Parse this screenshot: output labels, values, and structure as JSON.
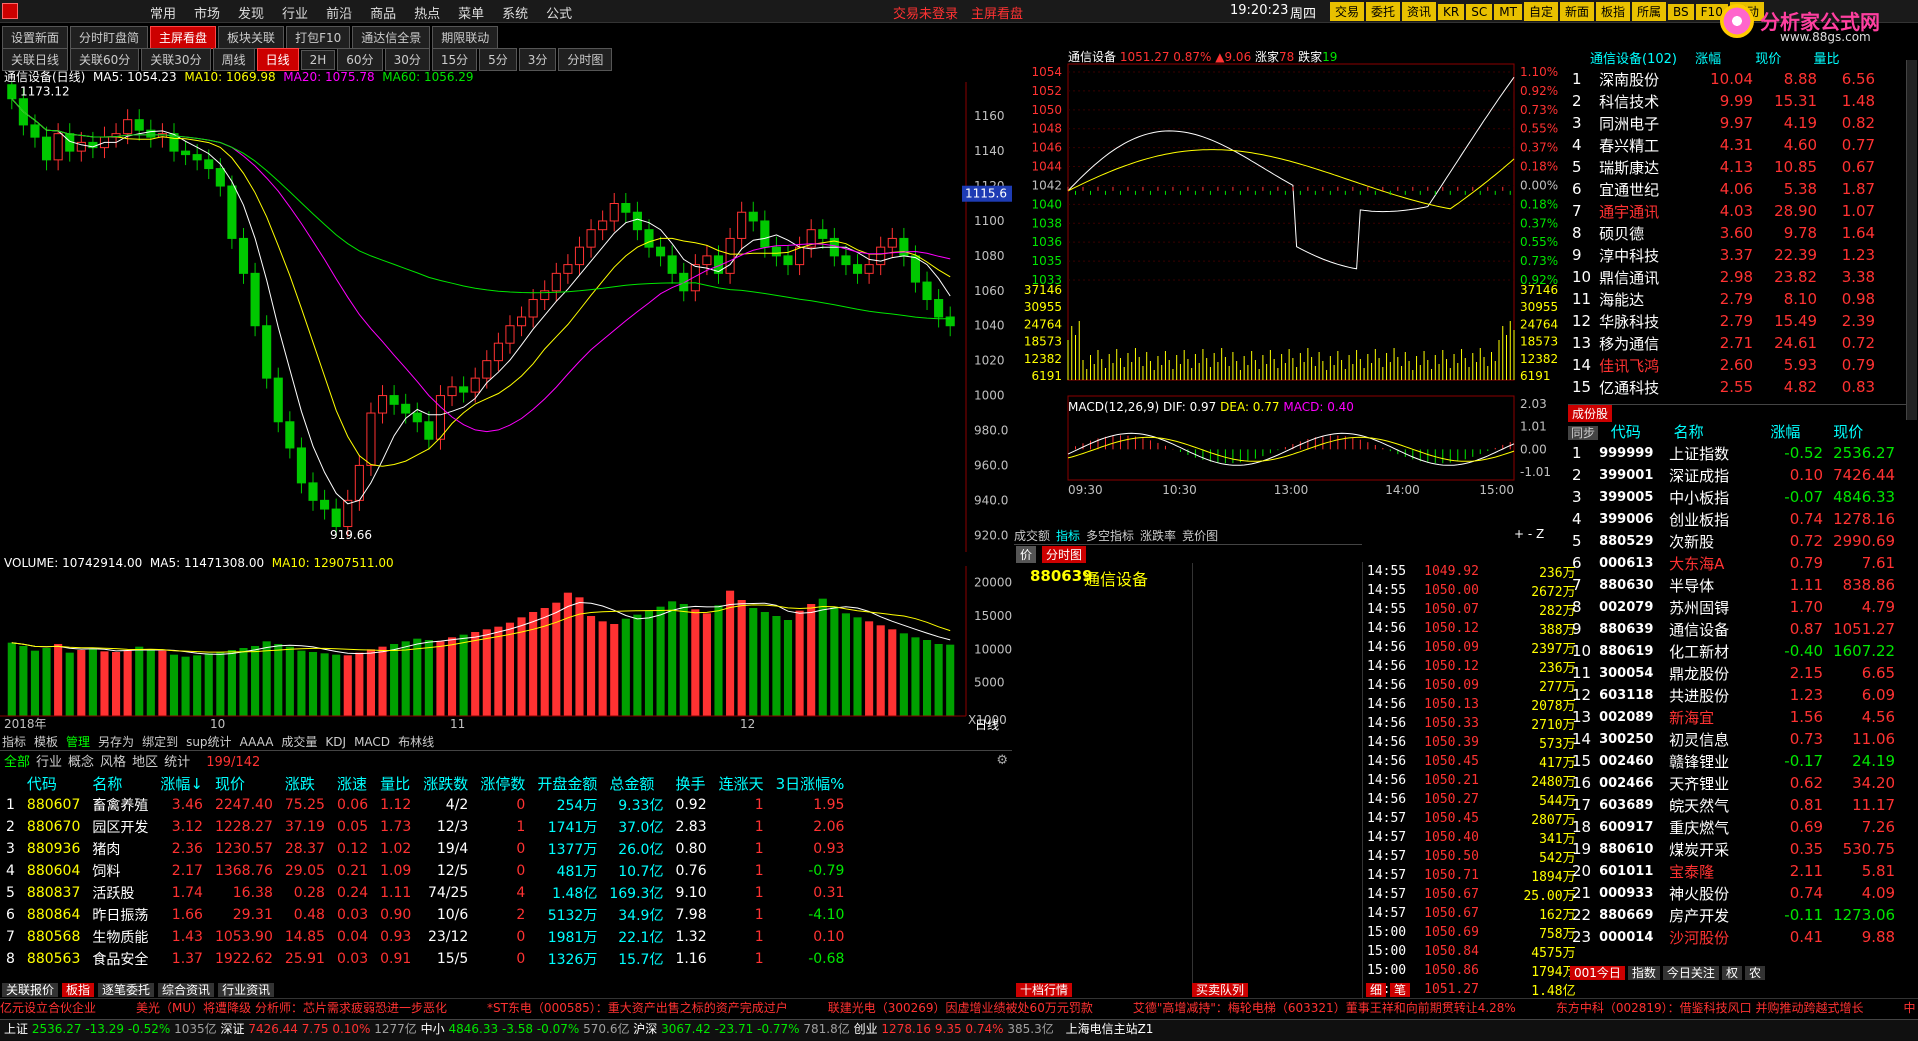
{
  "menu": {
    "items": [
      "常用",
      "市场",
      "发现",
      "行业",
      "前沿",
      "商品",
      "热点",
      "菜单",
      "系统",
      "公式"
    ],
    "login_hint": "交易未登录",
    "layout_name": "主屏看盘",
    "clock": "19:20:23",
    "weekday": "周四"
  },
  "toolbar": {
    "buttons": [
      "交易",
      "委托",
      "资讯",
      "KR",
      "SC",
      "MT",
      "自定",
      "新面",
      "板指",
      "所属",
      "BS",
      "F10",
      "联动"
    ]
  },
  "logo": {
    "text": "分析家公式网",
    "url": "www.88gs.com"
  },
  "top_tabs": [
    "设置新面",
    "分时盯盘简",
    "主屏看盘",
    "板块关联",
    "打包F10",
    "通达信全景",
    "期限联动"
  ],
  "period_tabs": [
    "关联日线",
    "关联60分",
    "关联30分",
    "周线",
    "日线",
    "2H",
    "60分",
    "30分",
    "15分",
    "5分",
    "3分",
    "分时图"
  ],
  "kline": {
    "title": "通信设备(日线)",
    "ma5": "MA5: 1054.23",
    "ma10": "MA10: 1069.98",
    "ma20": "MA20: 1075.78",
    "ma60": "MA60: 1056.29",
    "high_mark": "1173.12",
    "low_mark": "919.66",
    "price_ticks": [
      "1160",
      "1140",
      "1120",
      "1100",
      "1080",
      "1060",
      "1040",
      "1020",
      "1000",
      "980.0",
      "960.0",
      "940.0",
      "920.0"
    ],
    "last_price_tag": "1115.6"
  },
  "volume": {
    "label": "VOLUME: 10742914.00",
    "ma5": "MA5: 11471308.00",
    "ma10": "MA10: 12907511.00",
    "ticks": [
      "20000",
      "15000",
      "10000",
      "5000",
      "X1000"
    ],
    "dates": [
      "2018年",
      "10",
      "11",
      "12"
    ]
  },
  "indicator_tabs": [
    "指标",
    "模板",
    "管理",
    "另存为",
    "绑定到",
    "sup统计",
    "AAAA",
    "成交量",
    "KDJ",
    "MACD",
    "布林线"
  ],
  "period_label": "日线",
  "board": {
    "filter_tabs": [
      "全部",
      "行业",
      "概念",
      "风格",
      "地区",
      "统计"
    ],
    "count": "199/142",
    "headers": [
      "代码",
      "名称",
      "涨幅↓",
      "现价",
      "涨跌",
      "涨速",
      "量比",
      "涨跌数",
      "涨停数",
      "开盘金额",
      "总金额",
      "换手",
      "连涨天",
      "3日涨幅%"
    ],
    "rows": [
      [
        "1",
        "880607",
        "畜禽养殖",
        "3.46",
        "2247.40",
        "75.25",
        "0.06",
        "1.12",
        "4/2",
        "0",
        "254万",
        "9.33亿",
        "0.92",
        "1",
        "1.95"
      ],
      [
        "2",
        "880670",
        "园区开发",
        "3.12",
        "1228.27",
        "37.19",
        "0.05",
        "1.73",
        "12/3",
        "1",
        "1741万",
        "37.0亿",
        "2.83",
        "1",
        "2.06"
      ],
      [
        "3",
        "880936",
        "猪肉",
        "2.36",
        "1230.57",
        "28.37",
        "0.12",
        "1.02",
        "19/4",
        "0",
        "1377万",
        "26.0亿",
        "0.80",
        "1",
        "0.93"
      ],
      [
        "4",
        "880604",
        "饲料",
        "2.17",
        "1368.76",
        "29.05",
        "0.21",
        "1.09",
        "12/5",
        "0",
        "481万",
        "10.7亿",
        "0.76",
        "1",
        "-0.79"
      ],
      [
        "5",
        "880837",
        "活跃股",
        "1.74",
        "16.38",
        "0.28",
        "0.24",
        "1.11",
        "74/25",
        "4",
        "1.48亿",
        "169.3亿",
        "9.10",
        "1",
        "0.31"
      ],
      [
        "6",
        "880864",
        "昨日振荡",
        "1.66",
        "29.31",
        "0.48",
        "0.03",
        "0.90",
        "10/6",
        "2",
        "5132万",
        "34.9亿",
        "7.98",
        "1",
        "-4.10"
      ],
      [
        "7",
        "880568",
        "生物质能",
        "1.43",
        "1053.90",
        "14.85",
        "0.04",
        "0.93",
        "23/12",
        "0",
        "1981万",
        "22.1亿",
        "1.32",
        "1",
        "0.10"
      ],
      [
        "8",
        "880563",
        "食品安全",
        "1.37",
        "1922.62",
        "25.91",
        "0.03",
        "0.91",
        "15/5",
        "0",
        "1326万",
        "15.7亿",
        "1.16",
        "1",
        "-0.68"
      ]
    ]
  },
  "bottom_left_tabs": [
    "关联报价",
    "板指",
    "逐笔委托",
    "综合资讯",
    "行业资讯"
  ],
  "intraday": {
    "title": "通信设备",
    "price": "1051.27",
    "pct": "0.87%",
    "chg": "▲9.06",
    "up_label": "涨家",
    "up": "78",
    "down_label": "跌家",
    "down": "19",
    "price_ticks": [
      "1054",
      "1052",
      "1050",
      "1048",
      "1046",
      "1044",
      "1042",
      "1040",
      "1038",
      "1036",
      "1035",
      "1033"
    ],
    "pct_ticks": [
      "1.10%",
      "0.92%",
      "0.73%",
      "0.55%",
      "0.37%",
      "0.18%",
      "0.00%",
      "0.18%",
      "0.37%",
      "0.55%",
      "0.73%",
      "0.92%"
    ],
    "vol_ticks": [
      "37146",
      "30955",
      "24764",
      "18573",
      "12382",
      "6191"
    ],
    "macd_label": "MACD(12,26,9)",
    "dif": "DIF: 0.97",
    "dea": "DEA: 0.77",
    "macd": "MACD: 0.40",
    "macd_ticks": [
      "2.03",
      "1.01",
      "0.00",
      "-1.01"
    ],
    "time_ticks": [
      "09:30",
      "10:30",
      "13:00",
      "14:00",
      "15:00"
    ],
    "tabs": [
      "成交额",
      "指标",
      "多空指标",
      "涨跌率",
      "竞价图"
    ]
  },
  "quote": {
    "tab": "分时图",
    "code": "880639",
    "name": "通信设备",
    "bottom_tabs": [
      "十档行情",
      "买卖队列"
    ]
  },
  "ticks": {
    "rows": [
      [
        "14:55",
        "1049.92",
        "236万"
      ],
      [
        "14:55",
        "1050.00",
        "2672万"
      ],
      [
        "14:55",
        "1050.07",
        "282万"
      ],
      [
        "14:56",
        "1050.12",
        "388万"
      ],
      [
        "14:56",
        "1050.09",
        "2397万"
      ],
      [
        "14:56",
        "1050.12",
        "236万"
      ],
      [
        "14:56",
        "1050.09",
        "277万"
      ],
      [
        "14:56",
        "1050.13",
        "2078万"
      ],
      [
        "14:56",
        "1050.33",
        "2710万"
      ],
      [
        "14:56",
        "1050.39",
        "573万"
      ],
      [
        "14:56",
        "1050.45",
        "417万"
      ],
      [
        "14:56",
        "1050.21",
        "2480万"
      ],
      [
        "14:56",
        "1050.27",
        "544万"
      ],
      [
        "14:57",
        "1050.45",
        "2807万"
      ],
      [
        "14:57",
        "1050.40",
        "341万"
      ],
      [
        "14:57",
        "1050.50",
        "542万"
      ],
      [
        "14:57",
        "1050.71",
        "1894万"
      ],
      [
        "14:57",
        "1050.67",
        "25.00万"
      ],
      [
        "14:57",
        "1050.67",
        "162万"
      ],
      [
        "15:00",
        "1050.69",
        "758万"
      ],
      [
        "15:00",
        "1050.84",
        "4575万"
      ],
      [
        "15:00",
        "1050.86",
        "1794万"
      ],
      [
        "15:00",
        "1051.27",
        "1.48亿"
      ]
    ],
    "bottom_tabs": [
      "细",
      "笔"
    ]
  },
  "members": {
    "title": "通信设备",
    "count": "(102)",
    "headers": [
      "涨幅",
      "现价",
      "量比"
    ],
    "rows": [
      [
        "1",
        "深南股份",
        "10.04",
        "8.88",
        "6.56"
      ],
      [
        "2",
        "科信技术",
        "9.99",
        "15.31",
        "1.48"
      ],
      [
        "3",
        "同洲电子",
        "9.97",
        "4.19",
        "0.82"
      ],
      [
        "4",
        "春兴精工",
        "4.31",
        "4.60",
        "0.77"
      ],
      [
        "5",
        "瑞斯康达",
        "4.13",
        "10.85",
        "0.67"
      ],
      [
        "6",
        "宜通世纪",
        "4.06",
        "5.38",
        "1.87"
      ],
      [
        "7",
        "通宇通讯",
        "4.03",
        "28.90",
        "1.07"
      ],
      [
        "8",
        "硕贝德",
        "3.60",
        "9.78",
        "1.64"
      ],
      [
        "9",
        "淳中科技",
        "3.37",
        "22.39",
        "1.23"
      ],
      [
        "10",
        "鼎信通讯",
        "2.98",
        "23.82",
        "3.38"
      ],
      [
        "11",
        "海能达",
        "2.79",
        "8.10",
        "0.98"
      ],
      [
        "12",
        "华脉科技",
        "2.79",
        "15.49",
        "2.39"
      ],
      [
        "13",
        "移为通信",
        "2.71",
        "24.61",
        "0.72"
      ],
      [
        "14",
        "佳讯飞鸿",
        "2.60",
        "5.93",
        "0.79"
      ],
      [
        "15",
        "亿通科技",
        "2.55",
        "4.82",
        "0.83"
      ]
    ]
  },
  "indices": {
    "section": "成份股",
    "headers": [
      "代码",
      "名称",
      "涨幅",
      "现价"
    ],
    "sync": "同步",
    "rows": [
      [
        "1",
        "999999",
        "上证指数",
        "-0.52",
        "2536.27"
      ],
      [
        "2",
        "399001",
        "深证成指",
        "0.10",
        "7426.44"
      ],
      [
        "3",
        "399005",
        "中小板指",
        "-0.07",
        "4846.33"
      ],
      [
        "4",
        "399006",
        "创业板指",
        "0.74",
        "1278.16"
      ],
      [
        "5",
        "880529",
        "次新股",
        "0.72",
        "2990.69"
      ],
      [
        "6",
        "000613",
        "大东海A",
        "0.79",
        "7.61"
      ],
      [
        "7",
        "880630",
        "半导体",
        "1.11",
        "838.86"
      ],
      [
        "8",
        "002079",
        "苏州固锝",
        "1.70",
        "4.79"
      ],
      [
        "9",
        "880639",
        "通信设备",
        "0.87",
        "1051.27"
      ],
      [
        "10",
        "880619",
        "化工新材",
        "-0.40",
        "1607.22"
      ],
      [
        "11",
        "300054",
        "鼎龙股份",
        "2.15",
        "6.65"
      ],
      [
        "12",
        "603118",
        "共进股份",
        "1.23",
        "6.09"
      ],
      [
        "13",
        "002089",
        "新海宜",
        "1.56",
        "4.56"
      ],
      [
        "14",
        "300250",
        "初灵信息",
        "0.73",
        "11.06"
      ],
      [
        "15",
        "002460",
        "赣锋锂业",
        "-0.17",
        "24.19"
      ],
      [
        "16",
        "002466",
        "天齐锂业",
        "0.62",
        "34.20"
      ],
      [
        "17",
        "603689",
        "皖天然气",
        "0.81",
        "11.17"
      ],
      [
        "18",
        "600917",
        "重庆燃气",
        "0.69",
        "7.26"
      ],
      [
        "19",
        "880610",
        "煤炭开采",
        "0.35",
        "530.75"
      ],
      [
        "20",
        "601011",
        "宝泰隆",
        "2.11",
        "5.81"
      ],
      [
        "21",
        "000933",
        "神火股份",
        "0.74",
        "4.09"
      ],
      [
        "22",
        "880669",
        "房产开发",
        "-0.11",
        "1273.06"
      ],
      [
        "23",
        "000014",
        "沙河股份",
        "0.41",
        "9.88"
      ]
    ],
    "bottom_tabs": [
      "001今日",
      "指数",
      "今日关注",
      "权",
      "农"
    ]
  },
  "news": [
    "亿元设立合伙企业",
    "美光（MU）将遭降级 分析师：芯片需求疲弱恐进一步恶化",
    "*ST东电（000585）：重大资产出售之标的资产完成过户",
    "联建光电（300269）因虚增业绩被处60万元罚款",
    "艾德\"高增减持\"：梅轮电梯（603321）董事王祥和向前期贯转让4.28%",
    "东方中科（002819）：借鉴科技风口 并购推动跨越式增长",
    "中"
  ],
  "status": {
    "sh_label": "上证",
    "sh": "2536.27",
    "sh_chg": "-13.29",
    "sh_pct": "-0.52%",
    "sh_amt": "1035亿",
    "sz_label": "深证",
    "sz": "7426.44",
    "sz_chg": "7.75",
    "sz_pct": "0.10%",
    "sz_amt": "1277亿",
    "zx_label": "中小",
    "zx": "4846.33",
    "zx_chg": "-3.58",
    "zx_pct": "-0.07%",
    "zx_amt": "570.6亿",
    "hs_label": "沪深",
    "hs": "3067.42",
    "hs_chg": "-23.71",
    "hs_pct": "-0.77%",
    "hs_amt": "781.8亿",
    "cy_label": "创业",
    "cy": "1278.16",
    "cy_chg": "9.35",
    "cy_pct": "0.74%",
    "cy_amt": "385.3亿",
    "server": "上海电信主站Z1"
  }
}
